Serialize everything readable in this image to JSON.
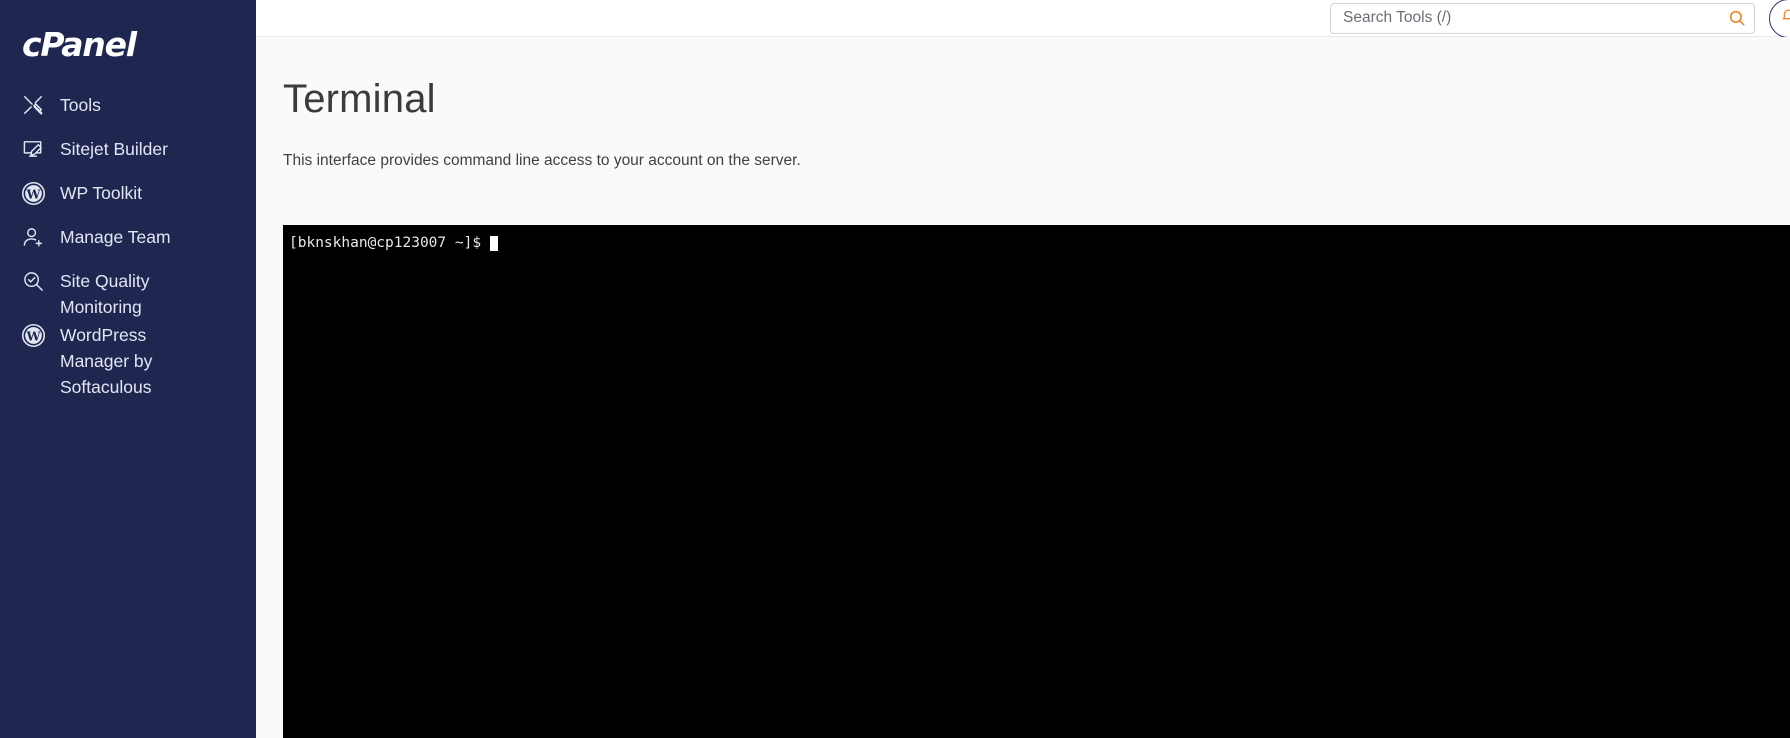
{
  "brand": {
    "name": "cPanel"
  },
  "sidebar": {
    "items": [
      {
        "label": "Tools",
        "icon": "tools-icon"
      },
      {
        "label": "Sitejet Builder",
        "icon": "monitor-pen-icon"
      },
      {
        "label": "WP Toolkit",
        "icon": "wordpress-icon"
      },
      {
        "label": "Manage Team",
        "icon": "user-add-icon"
      },
      {
        "label": "Site Quality Monitoring",
        "icon": "magnifier-check-icon"
      },
      {
        "label": "WordPress Manager by Softaculous",
        "icon": "wordpress-icon"
      }
    ]
  },
  "topbar": {
    "search": {
      "placeholder": "Search Tools (/)",
      "value": ""
    },
    "search_icon": "search-icon",
    "notifications_icon": "bell-icon"
  },
  "page": {
    "title": "Terminal",
    "description": "This interface provides command line access to your account on the server."
  },
  "terminal": {
    "prompt": "[bknskhan@cp123007 ~]$",
    "cursor": "block-cursor",
    "background": "#000000",
    "foreground": "#e8e8e8"
  },
  "colors": {
    "sidebar_bg": "#1f2750",
    "accent_orange": "#ef7f1a",
    "accent_blue": "#2a3570",
    "content_bg": "#fafafa"
  }
}
